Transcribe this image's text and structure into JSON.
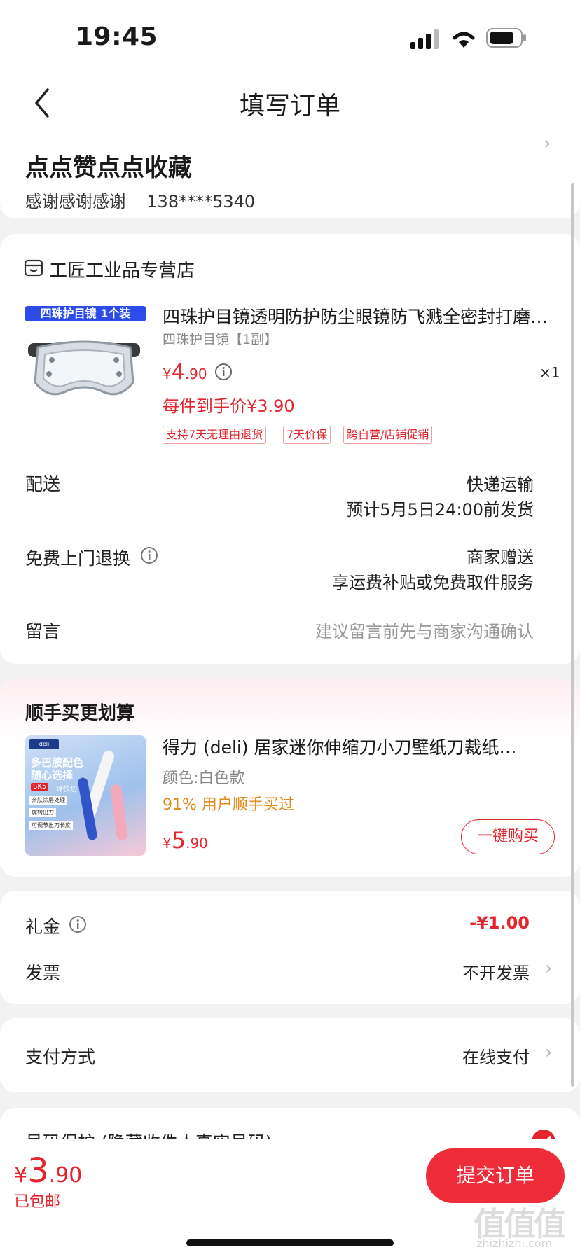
{
  "status_bar": {
    "time": "19:45"
  },
  "nav": {
    "title": "填写订单"
  },
  "address": {
    "name": "点点赞点点收藏",
    "recipient": "感谢感谢感谢",
    "phone": "138****5340"
  },
  "store": {
    "name": "工匠工业品专营店"
  },
  "product": {
    "badge": "四珠护目镜 1个装",
    "title": "四珠护目镜透明防护防尘眼镜防飞溅全密封打磨…",
    "spec": "四珠护目镜【1副】",
    "price_symbol": "¥",
    "price_int": "4",
    "price_dec": ".90",
    "quantity": "×1",
    "final_price": "每件到手价¥3.90",
    "services": [
      "支持7天无理由退货",
      "7天价保",
      "跨自营/店铺促销"
    ]
  },
  "delivery": {
    "label": "配送",
    "method": "快递运输",
    "eta": "预计5月5日24:00前发货"
  },
  "free_return": {
    "label": "免费上门退换",
    "value": "商家赠送",
    "sub": "享运费补贴或免费取件服务"
  },
  "message": {
    "label": "留言",
    "placeholder": "建议留言前先与商家沟通确认"
  },
  "upsell": {
    "heading": "顺手买更划算",
    "title": "得力 (deli) 居家迷你伸缩刀小刀壁纸刀裁纸…",
    "spec": "颜色:白色款",
    "popularity": "91% 用户顺手买过",
    "price_symbol": "¥",
    "price_int": "5",
    "price_dec": ".90",
    "button": "一键购买",
    "image_lines": [
      "多巴胺配色",
      "随心选择",
      "SK5",
      "锋快切",
      "亲肤涂层处理",
      "旋转出刀",
      "可调节出刀长度"
    ]
  },
  "gift": {
    "label": "礼金",
    "value": "-¥1.00"
  },
  "invoice": {
    "label": "发票",
    "value": "不开发票"
  },
  "payment": {
    "label": "支付方式",
    "value": "在线支付"
  },
  "privacy": {
    "label": "号码保护 (隐藏收件人真实号码)"
  },
  "footer": {
    "price_symbol": "¥",
    "price_int": "3",
    "price_dec": ".90",
    "shipping": "已包邮",
    "submit": "提交订单"
  },
  "watermark": {
    "glyphs": "值值值",
    "site": "zhizhizhi.com"
  },
  "colors": {
    "accent_red": "#e3262d",
    "submit_bg": "#ef2d3a",
    "badge_blue": "#2c4be8",
    "popularity_orange": "#e3891a"
  }
}
